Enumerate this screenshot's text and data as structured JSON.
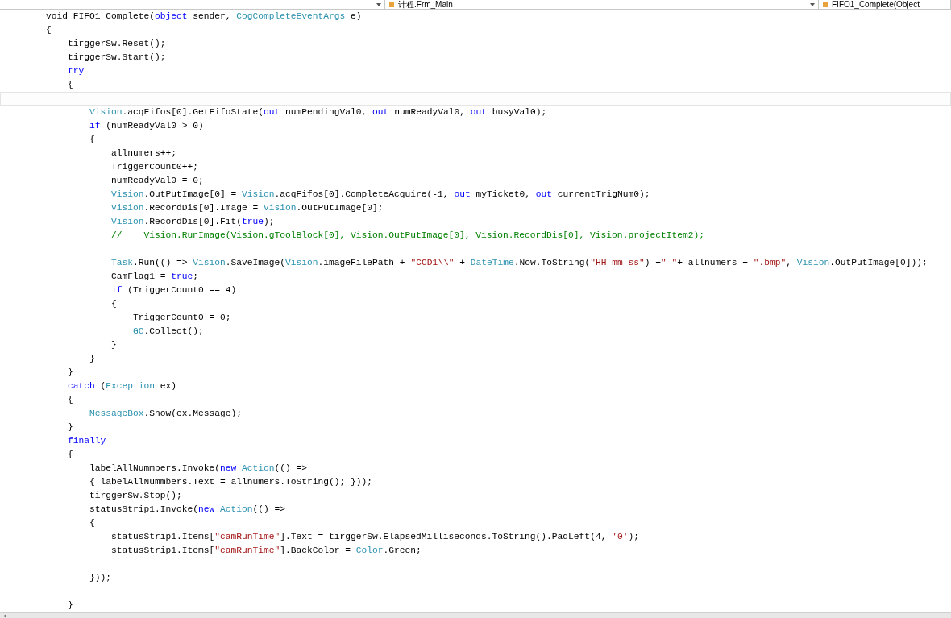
{
  "navigation_bar": {
    "dropdowns": [
      {
        "text": "计程.Frm_Main"
      },
      {
        "text": "FIFO1_Complete(Object"
      }
    ]
  },
  "editor": {
    "lines": [
      {
        "current": false,
        "tokens": [
          {
            "kind": "plain",
            "text": "        void FIFO1_Complete("
          },
          {
            "kind": "keyword",
            "text": "object"
          },
          {
            "kind": "plain",
            "text": " sender, "
          },
          {
            "kind": "type",
            "text": "CogCompleteEventArgs"
          },
          {
            "kind": "plain",
            "text": " e)"
          }
        ]
      },
      {
        "current": false,
        "tokens": [
          {
            "kind": "plain",
            "text": "        {"
          }
        ]
      },
      {
        "current": false,
        "tokens": [
          {
            "kind": "plain",
            "text": "            tirggerSw.Reset();"
          }
        ]
      },
      {
        "current": false,
        "tokens": [
          {
            "kind": "plain",
            "text": "            tirggerSw.Start();"
          }
        ]
      },
      {
        "current": false,
        "tokens": [
          {
            "kind": "keyword",
            "text": "            try"
          }
        ]
      },
      {
        "current": false,
        "tokens": [
          {
            "kind": "plain",
            "text": "            {"
          }
        ]
      },
      {
        "current": true
      },
      {
        "current": false,
        "tokens": [
          {
            "kind": "type",
            "text": "                Vision"
          },
          {
            "kind": "plain",
            "text": ".acqFifos[0].GetFifoState("
          },
          {
            "kind": "keyword",
            "text": "out"
          },
          {
            "kind": "plain",
            "text": " numPendingVal0, "
          },
          {
            "kind": "keyword",
            "text": "out"
          },
          {
            "kind": "plain",
            "text": " numReadyVal0, "
          },
          {
            "kind": "keyword",
            "text": "out"
          },
          {
            "kind": "plain",
            "text": " busyVal0);"
          }
        ]
      },
      {
        "current": false,
        "tokens": [
          {
            "kind": "keyword",
            "text": "                if"
          },
          {
            "kind": "plain",
            "text": " (numReadyVal0 > 0)"
          }
        ]
      },
      {
        "current": false,
        "tokens": [
          {
            "kind": "plain",
            "text": "                {"
          }
        ]
      },
      {
        "current": false,
        "tokens": [
          {
            "kind": "plain",
            "text": "                    allnumers++;"
          }
        ]
      },
      {
        "current": false,
        "tokens": [
          {
            "kind": "plain",
            "text": "                    TriggerCount0++;"
          }
        ]
      },
      {
        "current": false,
        "tokens": [
          {
            "kind": "plain",
            "text": "                    numReadyVal0 = 0;"
          }
        ]
      },
      {
        "current": false,
        "tokens": [
          {
            "kind": "type",
            "text": "                    Vision"
          },
          {
            "kind": "plain",
            "text": ".OutPutImage[0] = "
          },
          {
            "kind": "type",
            "text": "Vision"
          },
          {
            "kind": "plain",
            "text": ".acqFifos[0].CompleteAcquire(-1, "
          },
          {
            "kind": "keyword",
            "text": "out"
          },
          {
            "kind": "plain",
            "text": " myTicket0, "
          },
          {
            "kind": "keyword",
            "text": "out"
          },
          {
            "kind": "plain",
            "text": " currentTrigNum0);"
          }
        ]
      },
      {
        "current": false,
        "tokens": [
          {
            "kind": "type",
            "text": "                    Vision"
          },
          {
            "kind": "plain",
            "text": ".RecordDis[0].Image = "
          },
          {
            "kind": "type",
            "text": "Vision"
          },
          {
            "kind": "plain",
            "text": ".OutPutImage[0];"
          }
        ]
      },
      {
        "current": false,
        "tokens": [
          {
            "kind": "type",
            "text": "                    Vision"
          },
          {
            "kind": "plain",
            "text": ".RecordDis[0].Fit("
          },
          {
            "kind": "keyword",
            "text": "true"
          },
          {
            "kind": "plain",
            "text": ");"
          }
        ]
      },
      {
        "current": false,
        "tokens": [
          {
            "kind": "comment",
            "text": "                    //    Vision.RunImage(Vision.gToolBlock[0], Vision.OutPutImage[0], Vision.RecordDis[0], Vision.projectItem2);"
          }
        ]
      },
      {
        "current": false
      },
      {
        "current": false,
        "tokens": [
          {
            "kind": "type",
            "text": "                    Task"
          },
          {
            "kind": "plain",
            "text": ".Run(() => "
          },
          {
            "kind": "type",
            "text": "Vision"
          },
          {
            "kind": "plain",
            "text": ".SaveImage("
          },
          {
            "kind": "type",
            "text": "Vision"
          },
          {
            "kind": "plain",
            "text": ".imageFilePath + "
          },
          {
            "kind": "string",
            "text": "\"CCD1\\\\\""
          },
          {
            "kind": "plain",
            "text": " + "
          },
          {
            "kind": "type",
            "text": "DateTime"
          },
          {
            "kind": "plain",
            "text": ".Now.ToString("
          },
          {
            "kind": "string",
            "text": "\"HH-mm-ss\""
          },
          {
            "kind": "plain",
            "text": ") +"
          },
          {
            "kind": "string",
            "text": "\"-\""
          },
          {
            "kind": "plain",
            "text": "+ allnumers + "
          },
          {
            "kind": "string",
            "text": "\".bmp\""
          },
          {
            "kind": "plain",
            "text": ", "
          },
          {
            "kind": "type",
            "text": "Vision"
          },
          {
            "kind": "plain",
            "text": ".OutPutImage[0]));"
          }
        ]
      },
      {
        "current": false,
        "tokens": [
          {
            "kind": "plain",
            "text": "                    CamFlag1 = "
          },
          {
            "kind": "keyword",
            "text": "true"
          },
          {
            "kind": "plain",
            "text": ";"
          }
        ]
      },
      {
        "current": false,
        "tokens": [
          {
            "kind": "keyword",
            "text": "                    if"
          },
          {
            "kind": "plain",
            "text": " (TriggerCount0 == 4)"
          }
        ]
      },
      {
        "current": false,
        "tokens": [
          {
            "kind": "plain",
            "text": "                    {"
          }
        ]
      },
      {
        "current": false,
        "tokens": [
          {
            "kind": "plain",
            "text": "                        TriggerCount0 = 0;"
          }
        ]
      },
      {
        "current": false,
        "tokens": [
          {
            "kind": "type",
            "text": "                        GC"
          },
          {
            "kind": "plain",
            "text": ".Collect();"
          }
        ]
      },
      {
        "current": false,
        "tokens": [
          {
            "kind": "plain",
            "text": "                    }"
          }
        ]
      },
      {
        "current": false,
        "tokens": [
          {
            "kind": "plain",
            "text": "                }"
          }
        ]
      },
      {
        "current": false,
        "tokens": [
          {
            "kind": "plain",
            "text": "            }"
          }
        ]
      },
      {
        "current": false,
        "tokens": [
          {
            "kind": "keyword",
            "text": "            catch"
          },
          {
            "kind": "plain",
            "text": " ("
          },
          {
            "kind": "type",
            "text": "Exception"
          },
          {
            "kind": "plain",
            "text": " ex)"
          }
        ]
      },
      {
        "current": false,
        "tokens": [
          {
            "kind": "plain",
            "text": "            {"
          }
        ]
      },
      {
        "current": false,
        "tokens": [
          {
            "kind": "type",
            "text": "                MessageBox"
          },
          {
            "kind": "plain",
            "text": ".Show(ex.Message);"
          }
        ]
      },
      {
        "current": false,
        "tokens": [
          {
            "kind": "plain",
            "text": "            }"
          }
        ]
      },
      {
        "current": false,
        "tokens": [
          {
            "kind": "keyword",
            "text": "            finally"
          }
        ]
      },
      {
        "current": false,
        "tokens": [
          {
            "kind": "plain",
            "text": "            {"
          }
        ]
      },
      {
        "current": false,
        "tokens": [
          {
            "kind": "plain",
            "text": "                labelAllNummbers.Invoke("
          },
          {
            "kind": "keyword",
            "text": "new"
          },
          {
            "kind": "type",
            "text": " Action"
          },
          {
            "kind": "plain",
            "text": "(() =>"
          }
        ]
      },
      {
        "current": false,
        "tokens": [
          {
            "kind": "plain",
            "text": "                { labelAllNummbers.Text = allnumers.ToString(); }));"
          }
        ]
      },
      {
        "current": false,
        "tokens": [
          {
            "kind": "plain",
            "text": "                tirggerSw.Stop();"
          }
        ]
      },
      {
        "current": false,
        "tokens": [
          {
            "kind": "plain",
            "text": "                statusStrip1.Invoke("
          },
          {
            "kind": "keyword",
            "text": "new"
          },
          {
            "kind": "type",
            "text": " Action"
          },
          {
            "kind": "plain",
            "text": "(() =>"
          }
        ]
      },
      {
        "current": false,
        "tokens": [
          {
            "kind": "plain",
            "text": "                {"
          }
        ]
      },
      {
        "current": false,
        "tokens": [
          {
            "kind": "plain",
            "text": "                    statusStrip1.Items["
          },
          {
            "kind": "string",
            "text": "\"camRunTime\""
          },
          {
            "kind": "plain",
            "text": "].Text = tirggerSw.ElapsedMilliseconds.ToString().PadLeft(4, "
          },
          {
            "kind": "string",
            "text": "'0'"
          },
          {
            "kind": "plain",
            "text": ");"
          }
        ]
      },
      {
        "current": false,
        "tokens": [
          {
            "kind": "plain",
            "text": "                    statusStrip1.Items["
          },
          {
            "kind": "string",
            "text": "\"camRunTime\""
          },
          {
            "kind": "plain",
            "text": "].BackColor = "
          },
          {
            "kind": "type",
            "text": "Color"
          },
          {
            "kind": "plain",
            "text": ".Green;"
          }
        ]
      },
      {
        "current": false
      },
      {
        "current": false,
        "tokens": [
          {
            "kind": "plain",
            "text": "                }));"
          }
        ]
      },
      {
        "current": false
      },
      {
        "current": false,
        "tokens": [
          {
            "kind": "plain",
            "text": "            }"
          }
        ]
      }
    ]
  }
}
